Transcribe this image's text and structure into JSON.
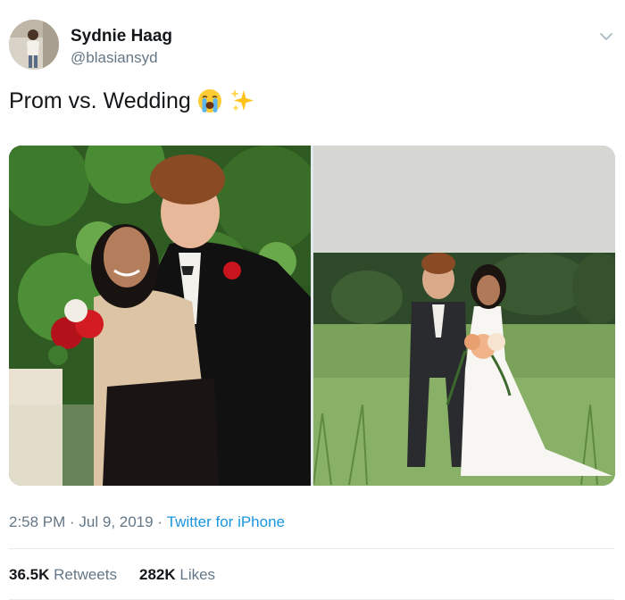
{
  "author": {
    "name": "Sydnie Haag",
    "handle": "@blasiansyd"
  },
  "tweet": {
    "text": "Prom vs. Wedding",
    "emojis": [
      "loudly-crying-face",
      "sparkles"
    ]
  },
  "media": {
    "photos": [
      "prom-photo",
      "wedding-photo"
    ]
  },
  "meta": {
    "time": "2:58 PM",
    "sep1": " · ",
    "date": "Jul 9, 2019",
    "sep2": " · ",
    "source": "Twitter for iPhone"
  },
  "stats": {
    "retweets_count": "36.5K",
    "retweets_label": "Retweets",
    "likes_count": "282K",
    "likes_label": "Likes"
  },
  "colors": {
    "link": "#1b95e0",
    "secondary_text": "#657786",
    "primary_text": "#14171a",
    "divider": "#e6ecf0"
  }
}
